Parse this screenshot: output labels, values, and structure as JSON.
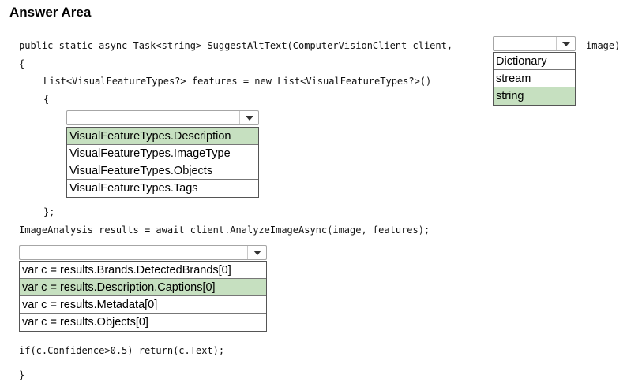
{
  "title": "Answer Area",
  "code": {
    "line1": "public static async Task<string> SuggestAltText(ComputerVisionClient client,",
    "line1_tail": "image)",
    "line2": "{",
    "line3": "List<VisualFeatureTypes?> features = new List<VisualFeatureTypes?>()",
    "line4": "{",
    "line5": "};",
    "line6": "ImageAnalysis results = await client.AnalyzeImageAsync(image, features);",
    "line7": "if(c.Confidence>0.5) return(c.Text);",
    "line8": "}"
  },
  "dropdown1": {
    "value": "",
    "options": [
      "Dictionary",
      "stream",
      "string"
    ],
    "selected_index": 2
  },
  "dropdown2": {
    "value": "",
    "options": [
      "VisualFeatureTypes.Description",
      "VisualFeatureTypes.ImageType",
      "VisualFeatureTypes.Objects",
      "VisualFeatureTypes.Tags"
    ],
    "selected_index": 0
  },
  "dropdown3": {
    "value": "",
    "options": [
      "var c = results.Brands.DetectedBrands[0]",
      "var c = results.Description.Captions[0]",
      "var c = results.Metadata[0]",
      "var c = results.Objects[0]"
    ],
    "selected_index": 1
  },
  "colors": {
    "selected": "#c6e0c0",
    "border": "#555555"
  },
  "icons": {
    "dropdown_arrow": "chevron-down-icon"
  }
}
